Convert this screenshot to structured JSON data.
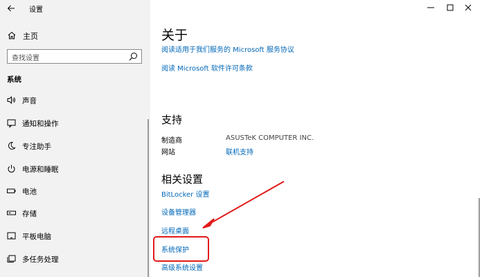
{
  "app": {
    "title": "设置"
  },
  "left": {
    "home_label": "主页",
    "search_placeholder": "查找设置",
    "section": "系统",
    "items": [
      {
        "label": "声音",
        "icon": "speaker-icon"
      },
      {
        "label": "通知和操作",
        "icon": "notification-icon"
      },
      {
        "label": "专注助手",
        "icon": "moon-icon"
      },
      {
        "label": "电源和睡眠",
        "icon": "power-icon"
      },
      {
        "label": "电池",
        "icon": "battery-icon"
      },
      {
        "label": "存储",
        "icon": "storage-icon"
      },
      {
        "label": "平板电脑",
        "icon": "tablet-icon"
      },
      {
        "label": "多任务处理",
        "icon": "multitask-icon"
      }
    ]
  },
  "main": {
    "title": "关于",
    "links_top": [
      "阅读适用于我们服务的 Microsoft 服务协议",
      "阅读 Microsoft 软件许可条款"
    ],
    "support": {
      "heading": "支持",
      "manufacturer_key": "制造商",
      "manufacturer_value": "ASUSTeK COMPUTER INC.",
      "website_key": "网站",
      "website_value": "联机支持"
    },
    "related": {
      "heading": "相关设置",
      "links": [
        "BitLocker 设置",
        "设备管理器",
        "远程桌面",
        "系统保护",
        "高级系统设置"
      ]
    }
  },
  "colors": {
    "link": "#0067b8",
    "annotation": "#e21a1a",
    "sidebar_bg": "#f2f2f2"
  }
}
